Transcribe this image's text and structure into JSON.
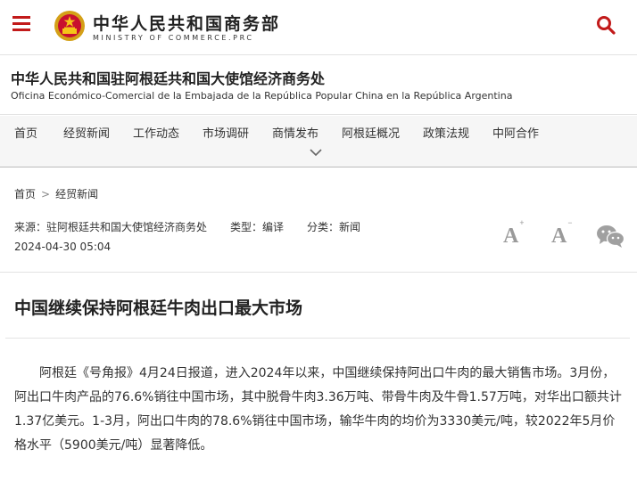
{
  "header": {
    "brand_cn": "中华人民共和国商务部",
    "brand_en": "MINISTRY OF COMMERCE.PRC",
    "menu_icon": "hamburger-menu-icon",
    "search_icon": "search-icon",
    "brand_color": "#c21a1a"
  },
  "office": {
    "name_cn": "中华人民共和国驻阿根廷共和国大使馆经济商务处",
    "name_es": "Oficina Económico-Comercial de la Embajada de la República Popular China en la República Argentina"
  },
  "nav": {
    "items": [
      "首页",
      "经贸新闻",
      "工作动态",
      "市场调研",
      "商情发布",
      "阿根廷概况",
      "政策法规",
      "中阿合作"
    ]
  },
  "breadcrumb": {
    "home": "首页",
    "separator": ">",
    "current": "经贸新闻"
  },
  "meta": {
    "source": "来源：驻阿根廷共和国大使馆经济商务处",
    "type": "类型：编译",
    "category": "分类：新闻",
    "date": "2024-04-30 05:04",
    "font_larger_label": "A",
    "font_smaller_label": "A",
    "share_icon": "wechat-icon"
  },
  "article": {
    "title": "中国继续保持阿根廷牛肉出口最大市场",
    "body": "阿根廷《号角报》4月24日报道，进入2024年以来，中国继续保持阿出口牛肉的最大销售市场。3月份，阿出口牛肉产品的76.6%销往中国市场，其中脱骨牛肉3.36万吨、带骨牛肉及牛骨1.57万吨，对华出口额共计1.37亿美元。1-3月，阿出口牛肉的78.6%销往中国市场，输华牛肉的均价为3330美元/吨，较2022年5月价格水平（5900美元/吨）显著降低。"
  }
}
